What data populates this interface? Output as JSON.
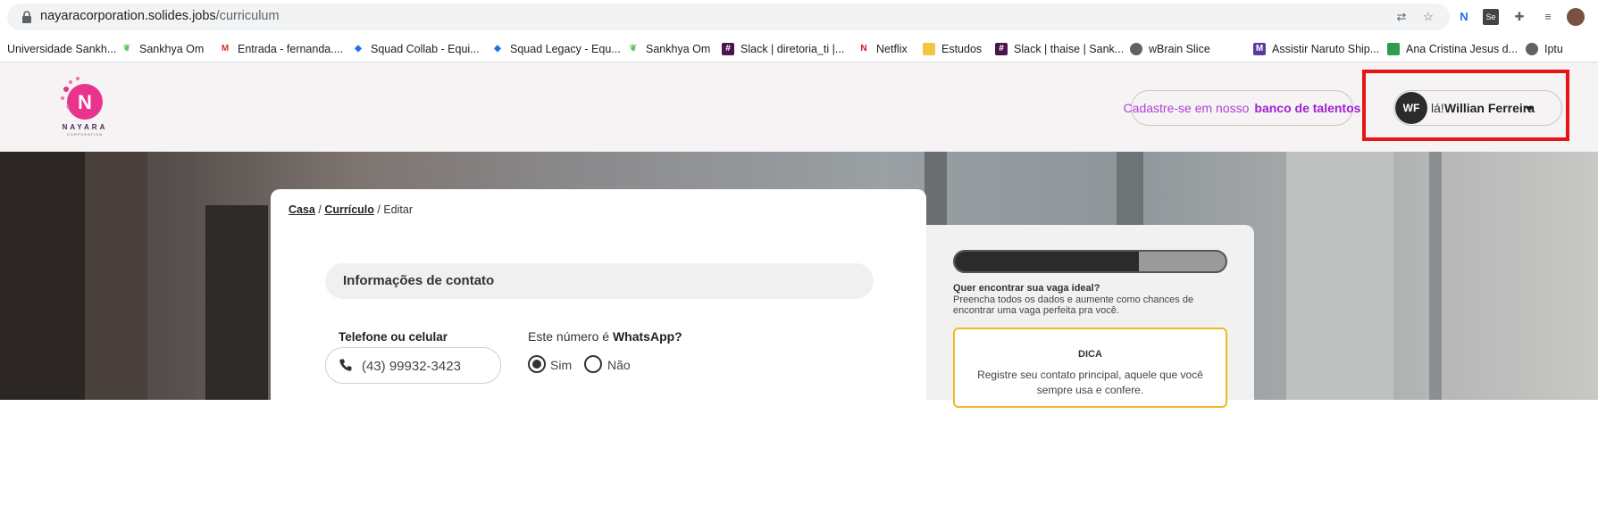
{
  "browser": {
    "url_domain": "nayaracorporation.solides.jobs",
    "url_path": "/curriculum",
    "bookmarks": [
      {
        "label": "Universidade Sankh...",
        "icon": "sankhya-icon"
      },
      {
        "label": "Sankhya Om",
        "icon": "leaf-icon"
      },
      {
        "label": "Entrada - fernanda....",
        "icon": "gmail-icon"
      },
      {
        "label": "Squad Collab - Equi...",
        "icon": "jira-icon"
      },
      {
        "label": "Squad Legacy - Equ...",
        "icon": "jira-icon"
      },
      {
        "label": "Sankhya Om",
        "icon": "leaf-icon"
      },
      {
        "label": "Slack | diretoria_ti |...",
        "icon": "slack-icon"
      },
      {
        "label": "Netflix",
        "icon": "netflix-icon"
      },
      {
        "label": "Estudos",
        "icon": "folder-icon"
      },
      {
        "label": "Slack | thaise | Sank...",
        "icon": "slack-icon"
      },
      {
        "label": "wBrain Slice",
        "icon": "globe-icon"
      },
      {
        "label": "Assistir Naruto Ship...",
        "icon": "naruto-icon"
      },
      {
        "label": "Ana Cristina Jesus d...",
        "icon": "bookmark-icon"
      },
      {
        "label": "Iptu",
        "icon": "globe-icon"
      }
    ]
  },
  "header": {
    "logo_text": "NAYARA",
    "logo_subtext": "CORPORATION",
    "talent_prefix": "Cadastre-se em nosso",
    "talent_link": "banco de talentos",
    "avatar_initials": "WF",
    "greeting": "lá!",
    "user_name": "Willian Ferreira"
  },
  "breadcrumb": {
    "home": "Casa",
    "curriculum": "Currículo",
    "current": "Editar"
  },
  "contact": {
    "section_title": "Informações de contato",
    "phone_label": "Telefone ou celular",
    "phone_value": "(43) 99932-3423",
    "whatsapp_question_prefix": "Este número é",
    "whatsapp_question_bold": "WhatsApp?",
    "option_yes": "Sim",
    "option_no": "Não",
    "whatsapp_selected": "Sim"
  },
  "sidebar": {
    "progress_fraction": 0.68,
    "goal_title": "Quer encontrar sua vaga ideal?",
    "goal_text": "Preencha todos os dados e aumente como chances de encontrar uma vaga perfeita pra você.",
    "tip_title": "DICA",
    "tip_text": "Registre seu contato principal, aquele que você sempre usa e confere."
  },
  "colors": {
    "accent": "#a020d0",
    "highlight_box": "#e81414",
    "tip_border": "#f3b723"
  }
}
